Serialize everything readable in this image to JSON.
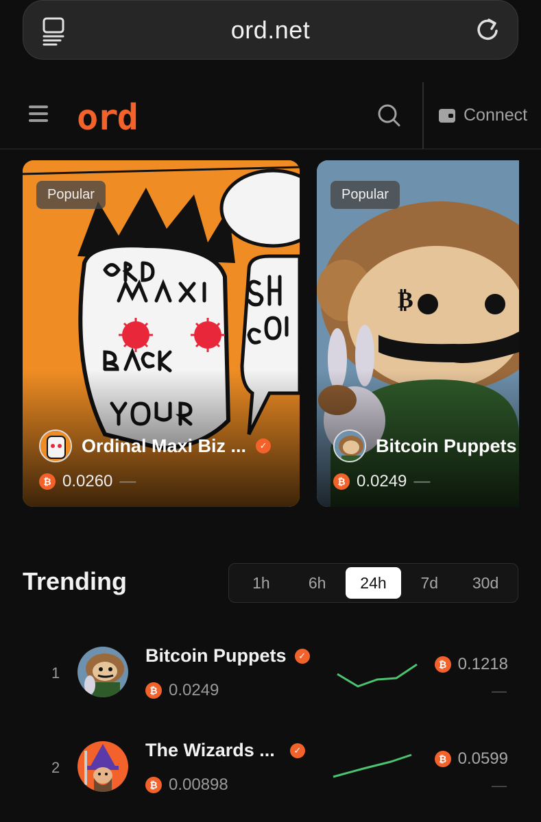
{
  "browser": {
    "url": "ord.net",
    "icons": [
      "tabs-icon",
      "reload-icon"
    ]
  },
  "header": {
    "logo": "ord",
    "connect_label": "Connect",
    "icons": [
      "menu-icon",
      "search-icon",
      "wallet-icon"
    ]
  },
  "featured": [
    {
      "badge": "Popular",
      "name": "Ordinal Maxi Biz ...",
      "verified": true,
      "price": "0.0260",
      "change": "—"
    },
    {
      "badge": "Popular",
      "name": "Bitcoin Puppets",
      "verified": false,
      "price": "0.0249",
      "change": "—"
    }
  ],
  "trending": {
    "title": "Trending",
    "periods": [
      "1h",
      "6h",
      "24h",
      "7d",
      "30d"
    ],
    "active_period": "24h",
    "rows": [
      {
        "rank": "1",
        "name": "Bitcoin Puppets",
        "verified": true,
        "floor": "0.0249",
        "volume": "0.1218",
        "change": "—"
      },
      {
        "rank": "2",
        "name": "The Wizards ...",
        "verified": true,
        "floor": "0.00898",
        "volume": "0.0599",
        "change": "—"
      }
    ]
  },
  "colors": {
    "accent": "#f2622a",
    "background": "#0e0e0e",
    "sparkline": "#4cc46f"
  },
  "currency_symbol": "₿"
}
